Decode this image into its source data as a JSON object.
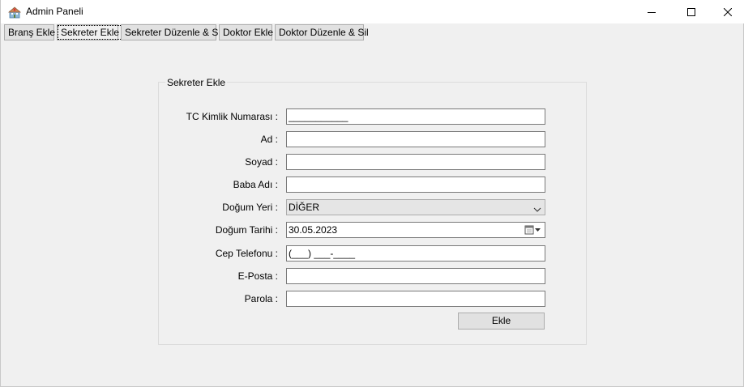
{
  "window": {
    "title": "Admin Paneli",
    "icon": "hospital-app-icon"
  },
  "tabs": [
    {
      "label": "Branş Ekle",
      "active": false
    },
    {
      "label": "Sekreter Ekle",
      "active": true
    },
    {
      "label": "Sekreter Düzenle & Sil",
      "active": false
    },
    {
      "label": "Doktor Ekle",
      "active": false
    },
    {
      "label": "Doktor Düzenle & Sil",
      "active": false
    }
  ],
  "form": {
    "group_title": "Sekreter Ekle",
    "fields": {
      "tc": {
        "label": "TC Kimlik Numarası :",
        "value": "___________"
      },
      "ad": {
        "label": "Ad :",
        "value": ""
      },
      "soyad": {
        "label": "Soyad :",
        "value": ""
      },
      "baba_adi": {
        "label": "Baba Adı :",
        "value": ""
      },
      "dogum_yeri": {
        "label": "Doğum Yeri :",
        "value": "DİĞER"
      },
      "dogum_tarihi": {
        "label": "Doğum Tarihi :",
        "value": "30.05.2023"
      },
      "cep_telefonu": {
        "label": "Cep Telefonu :",
        "value": "(___) ___-____"
      },
      "eposta": {
        "label": "E-Posta :",
        "value": ""
      },
      "parola": {
        "label": "Parola :",
        "value": ""
      }
    },
    "submit_label": "Ekle"
  }
}
